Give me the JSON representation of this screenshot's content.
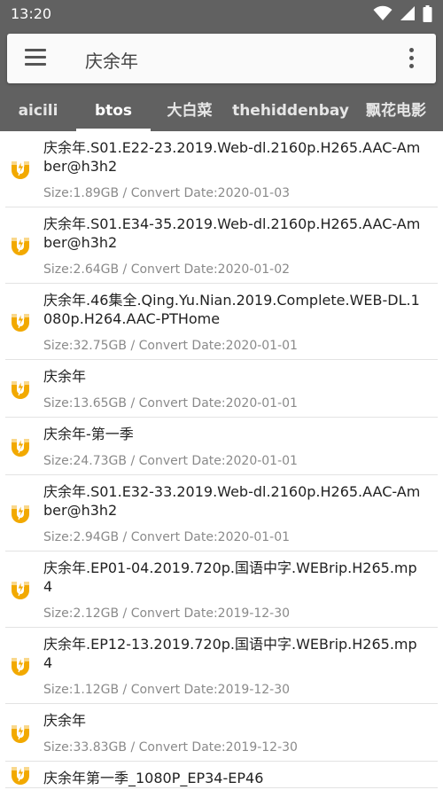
{
  "status": {
    "time": "13:20"
  },
  "search": {
    "value": "庆余年"
  },
  "tabs": [
    {
      "label": "aicili"
    },
    {
      "label": "btos"
    },
    {
      "label": "大白菜"
    },
    {
      "label": "thehiddenbay"
    },
    {
      "label": "飘花电影"
    }
  ],
  "active_tab": "btos",
  "colors": {
    "toolbar": "#616161",
    "magnet_icon": "#f2a900"
  },
  "items": [
    {
      "title": "庆余年.S01.E22-23.2019.Web-dl.2160p.H265.AAC-Amber@h3h2",
      "meta": "Size:1.89GB / Convert Date:2020-01-03"
    },
    {
      "title": "庆余年.S01.E34-35.2019.Web-dl.2160p.H265.AAC-Amber@h3h2",
      "meta": "Size:2.64GB / Convert Date:2020-01-02"
    },
    {
      "title": "庆余年.46集全.Qing.Yu.Nian.2019.Complete.WEB-DL.1080p.H264.AAC-PTHome",
      "meta": "Size:32.75GB / Convert Date:2020-01-01"
    },
    {
      "title": "庆余年",
      "meta": "Size:13.65GB / Convert Date:2020-01-01"
    },
    {
      "title": "庆余年-第一季",
      "meta": "Size:24.73GB / Convert Date:2020-01-01"
    },
    {
      "title": "庆余年.S01.E32-33.2019.Web-dl.2160p.H265.AAC-Amber@h3h2",
      "meta": "Size:2.94GB / Convert Date:2020-01-01"
    },
    {
      "title": "庆余年.EP01-04.2019.720p.国语中字.WEBrip.H265.mp4",
      "meta": "Size:2.12GB / Convert Date:2019-12-30"
    },
    {
      "title": "庆余年.EP12-13.2019.720p.国语中字.WEBrip.H265.mp4",
      "meta": "Size:1.12GB / Convert Date:2019-12-30"
    },
    {
      "title": "庆余年",
      "meta": "Size:33.83GB / Convert Date:2019-12-30"
    },
    {
      "title": "庆余年第一季_1080P_EP34-EP46",
      "meta": ""
    }
  ]
}
